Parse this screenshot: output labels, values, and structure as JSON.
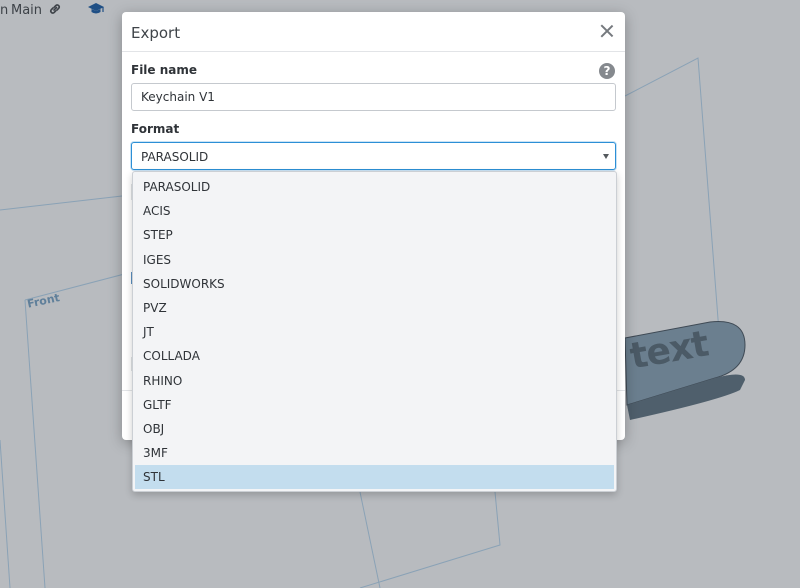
{
  "topbar": {
    "crumb_fragment": "n",
    "crumb_label": "Main",
    "link_icon": "link-icon",
    "cap_icon": "graduation-cap-icon"
  },
  "viewport": {
    "front_label": "Front",
    "model_text": "text"
  },
  "dialog": {
    "title": "Export",
    "file_name_label": "File name",
    "file_name_value": "Keychain V1",
    "format_label": "Format",
    "format_selected": "PARASOLID"
  },
  "format_options": [
    "PARASOLID",
    "ACIS",
    "STEP",
    "IGES",
    "SOLIDWORKS",
    "PVZ",
    "JT",
    "COLLADA",
    "RHINO",
    "GLTF",
    "OBJ",
    "3MF",
    "STL"
  ],
  "highlighted_option": "STL",
  "colors": {
    "focus_border": "#2c8fd6",
    "highlight": "#c3ddee",
    "viewport_bg": "#b8bbbf"
  }
}
